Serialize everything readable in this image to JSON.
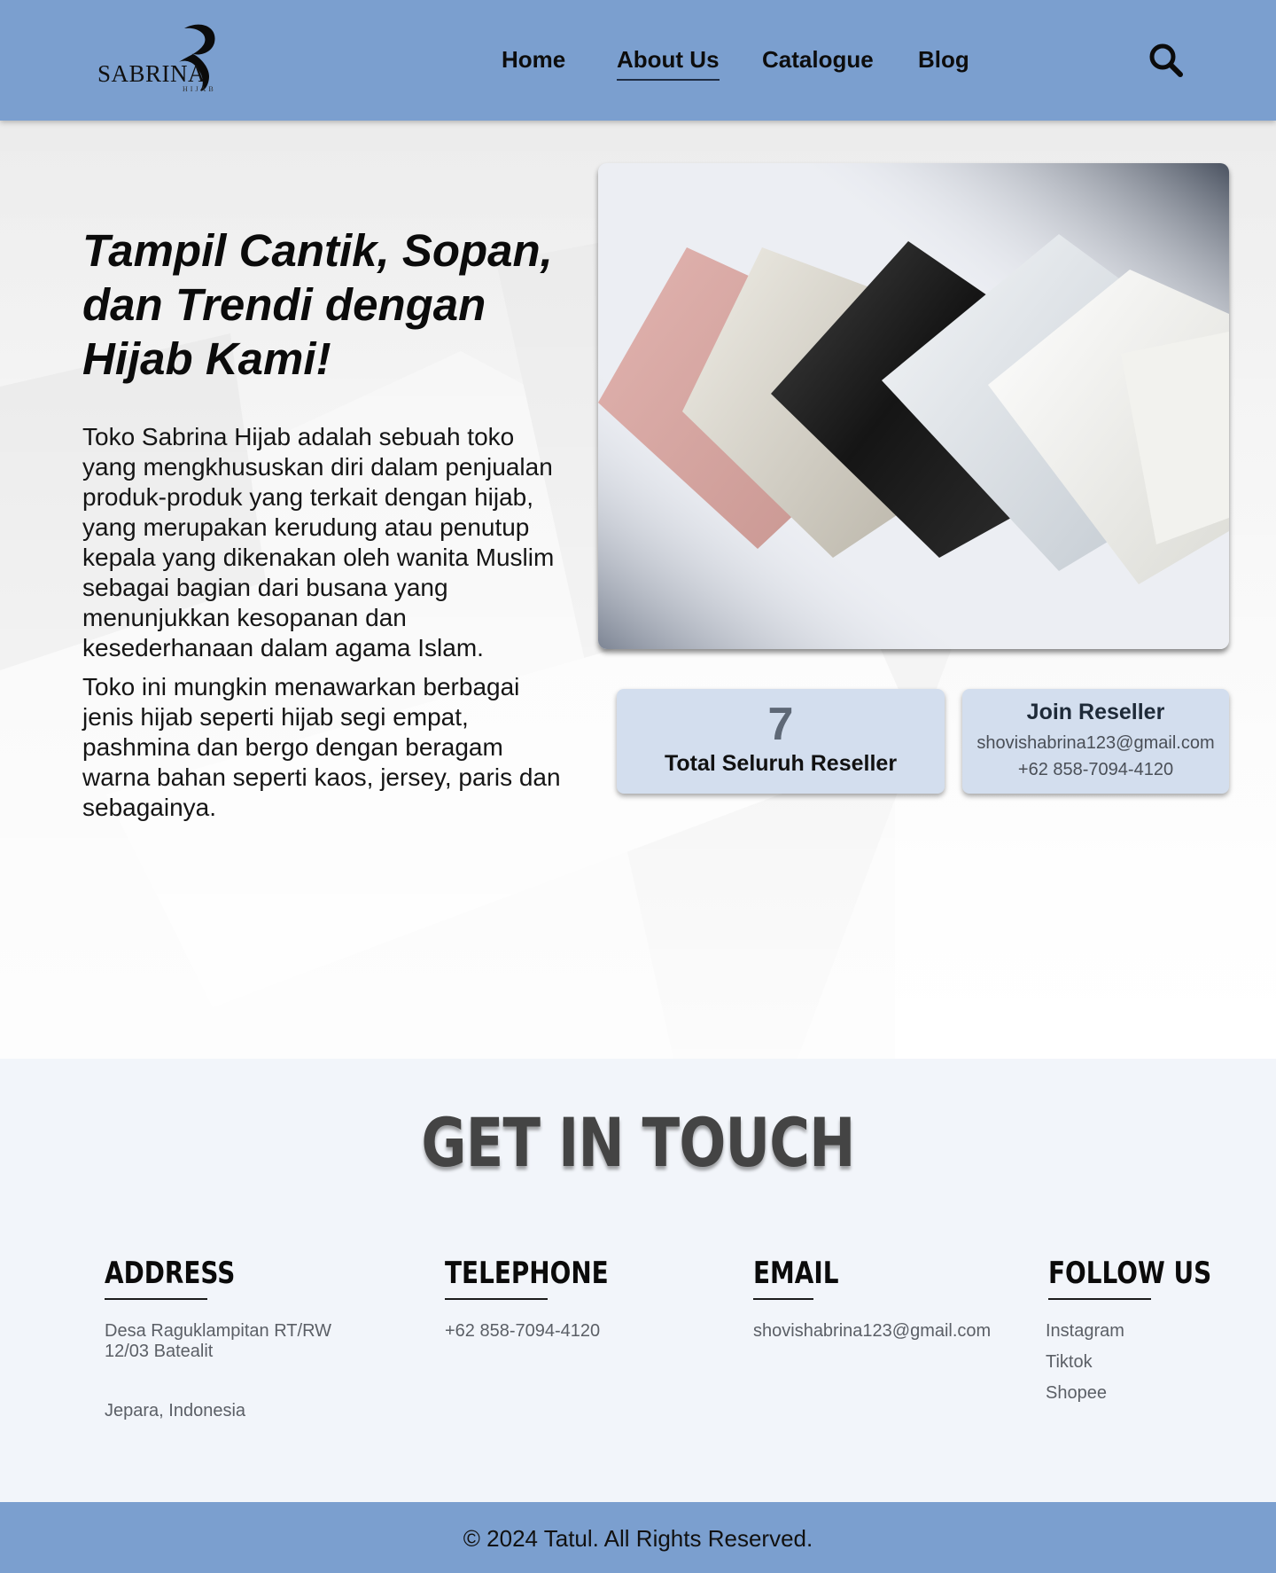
{
  "header": {
    "logo_text": "SABRINA",
    "logo_sub": "HIJAB",
    "nav": [
      {
        "label": "Home"
      },
      {
        "label": "About Us"
      },
      {
        "label": "Catalogue"
      },
      {
        "label": "Blog"
      }
    ],
    "active_nav": "About Us",
    "search_icon": "search-icon"
  },
  "hero": {
    "title": "Tampil Cantik, Sopan, dan Trendi dengan Hijab Kami!",
    "paragraph_1": "Toko Sabrina Hijab adalah sebuah toko yang mengkhususkan diri dalam penjualan produk-produk yang terkait dengan hijab, yang merupakan kerudung atau penutup kepala yang dikenakan oleh wanita Muslim sebagai bagian dari busana yang menunjukkan kesopanan dan kesederhanaan dalam agama Islam.",
    "paragraph_2": "Toko ini mungkin menawarkan berbagai jenis hijab seperti hijab segi empat, pashmina dan bergo dengan beragam warna bahan seperti kaos, jersey, paris dan sebagainya.",
    "reseller_count": "7",
    "reseller_label": "Total Seluruh Reseller",
    "join_title": "Join Reseller",
    "join_email": "shovishabrina123@gmail.com",
    "join_phone": "+62 858-7094-4120"
  },
  "contact": {
    "heading": "GET IN TOUCH",
    "address": {
      "title": "ADDRESS",
      "line_1": "Desa Raguklampitan RT/RW",
      "line_2": "12/03 Batealit",
      "line_3": "Jepara, Indonesia"
    },
    "telephone": {
      "title": "TELEPHONE",
      "value": "+62 858-7094-4120"
    },
    "email": {
      "title": "EMAIL",
      "value": "shovishabrina123@gmail.com"
    },
    "follow": {
      "title": "FOLLOW US",
      "links": [
        "Instagram",
        "Tiktok",
        "Shopee"
      ]
    }
  },
  "footer": {
    "copyright": "© 2024 Tatul. All Rights Reserved."
  },
  "colors": {
    "nav_bg": "#7b9fcf",
    "card_bg": "#d3deee",
    "contact_bg": "#f2f5fa"
  }
}
